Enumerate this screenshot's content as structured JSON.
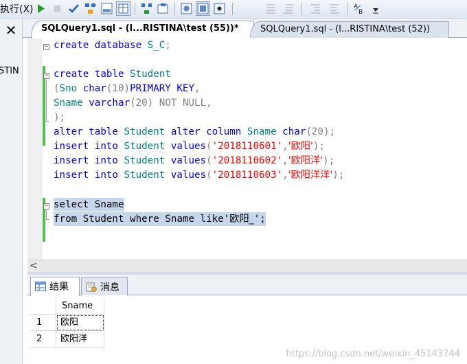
{
  "toolbar": {
    "run_label": "执行(X)"
  },
  "left_panel": {
    "close_glyph": "✕",
    "partial_text": "STIN"
  },
  "tabs": [
    {
      "label": "SQLQuery1.sql - (l...RISTINA\\test (55))*",
      "active": true
    },
    {
      "label": "SQLQuery1.sql - (l...RISTINA\\test (52))",
      "active": false
    }
  ],
  "code": {
    "line1": {
      "kw": "create database",
      "name": " S_C",
      "punct": ";"
    },
    "line3": {
      "kw": "create table",
      "name": " Student"
    },
    "line4": {
      "open": "(",
      "col": "Sno",
      "type": " char",
      "args": "(10)",
      "constraint": "PRIMARY KEY",
      "tail": ","
    },
    "line5": {
      "col": "Sname",
      "type": " varchar",
      "args": "(20)",
      "constraint": " NOT NULL",
      "tail": ","
    },
    "line6": {
      "text": ");"
    },
    "line7": {
      "kw1": "alter table",
      "tbl": " Student",
      "kw2": " alter column",
      "col": " Sname",
      "type": " char",
      "args": "(20);"
    },
    "inserts": [
      {
        "kw1": "insert into",
        "tbl": " Student",
        "kw2": " values",
        "open": "(",
        "id": "'2018110601'",
        "comma": ",",
        "name": "'欧阳'",
        "close": ");"
      },
      {
        "kw1": "insert into",
        "tbl": " Student",
        "kw2": " values",
        "open": "(",
        "id": "'2018110602'",
        "comma": ",",
        "name": "'欧阳洋'",
        "close": ");"
      },
      {
        "kw1": "insert into",
        "tbl": " Student",
        "kw2": " values",
        "open": "(",
        "id": "'2018110603'",
        "comma": ",",
        "name": "'欧阳洋洋'",
        "close": ");"
      }
    ],
    "select_line": "select Sname",
    "from_line": "from Student where Sname like'",
    "from_cjk": "欧阳_",
    "from_end": "';"
  },
  "results": {
    "tab_results": "结果",
    "tab_messages": "消息",
    "column": "Sname",
    "rows": [
      {
        "num": "1",
        "value": "欧阳"
      },
      {
        "num": "2",
        "value": "欧阳洋"
      }
    ]
  },
  "watermark": "https://blog.csdn.net/weixin_45143744",
  "colors": {
    "keyword": "#0000ff",
    "object": "#008080",
    "string": "#ff0000",
    "comment_gray": "#808080",
    "selection": "#c6d6ec",
    "change_bar": "#4cc14c"
  }
}
